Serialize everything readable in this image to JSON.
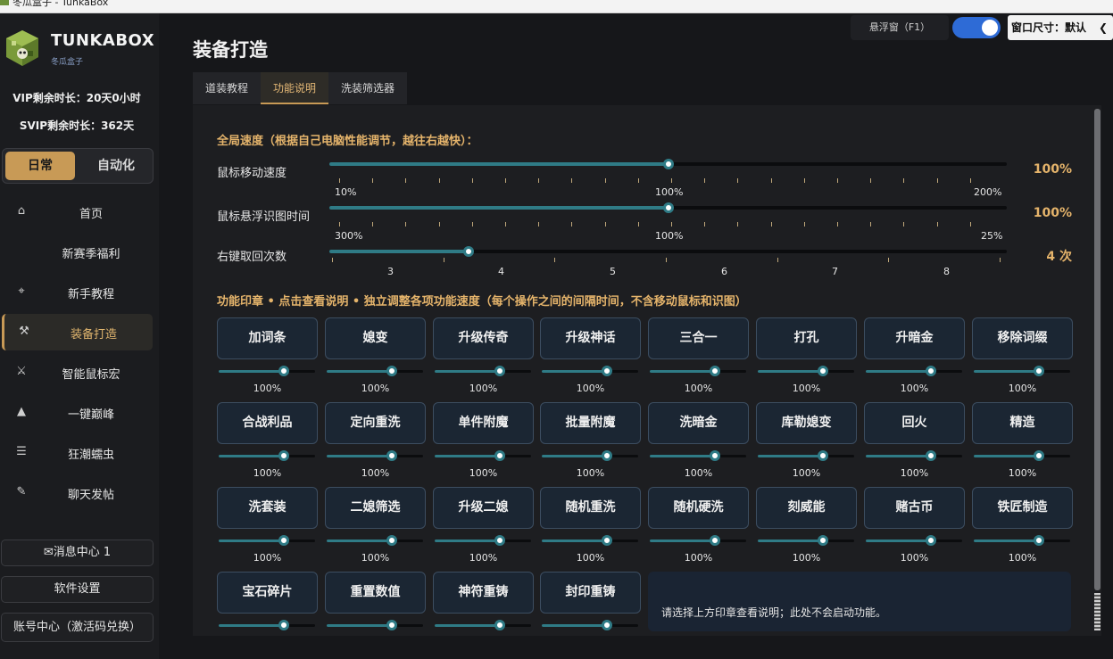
{
  "window": {
    "title": "冬瓜盒子 - TunkaBox"
  },
  "app": {
    "brand": "TUNKABOX",
    "brand_sub": "冬瓜盒子",
    "vip": "VIP剩余时长：20天0小时",
    "svip": "SVIP剩余时长：362天"
  },
  "mode": {
    "daily": "日常",
    "auto": "自动化"
  },
  "nav": [
    {
      "label": "首页",
      "icon": "home-icon",
      "glyph": "⌂"
    },
    {
      "label": "新赛季福利",
      "icon": "",
      "glyph": ""
    },
    {
      "label": "新手教程",
      "icon": "crosshair-icon",
      "glyph": "⌖"
    },
    {
      "label": "装备打造",
      "icon": "hammer-icon",
      "glyph": "⚒"
    },
    {
      "label": "智能鼠标宏",
      "icon": "swords-icon",
      "glyph": "⚔"
    },
    {
      "label": "一键巅峰",
      "icon": "triangle-up-icon",
      "glyph": "▲"
    },
    {
      "label": "狂潮蠕虫",
      "icon": "list-icon",
      "glyph": "☰"
    },
    {
      "label": "聊天发帖",
      "icon": "pen-icon",
      "glyph": "✎"
    }
  ],
  "side_buttons": {
    "messages": "✉消息中心  1",
    "settings": "软件设置",
    "account": "账号中心（激活码兑换）"
  },
  "topbar": {
    "float_label": "悬浮窗（F1）",
    "float_on": true,
    "window_size": "窗口尺寸：默认"
  },
  "page": {
    "title": "装备打造",
    "tabs": [
      "道装教程",
      "功能说明",
      "洗装筛选器"
    ],
    "active_tab": 1
  },
  "speed": {
    "heading": "全局速度（根据自己电脑性能调节，越往右越快）：",
    "sliders": [
      {
        "label": "鼠标移动速度",
        "value": "100%",
        "ticks": [
          "10%",
          "100%",
          "200%"
        ]
      },
      {
        "label": "鼠标悬浮识图时间",
        "value": "100%",
        "ticks": [
          "300%",
          "100%",
          "25%"
        ]
      },
      {
        "label": "右键取回次数",
        "value": "4 次",
        "ticks": [
          "3",
          "4",
          "5",
          "6",
          "7",
          "8"
        ]
      }
    ]
  },
  "functions": {
    "heading": "功能印章 • 点击查看说明 • 独立调整各项功能速度（每个操作之间的间隔时间，不含移动鼠标和识图）",
    "items": [
      {
        "label": "加词条",
        "pct": "100%"
      },
      {
        "label": "媳变",
        "pct": "100%"
      },
      {
        "label": "升级传奇",
        "pct": "100%"
      },
      {
        "label": "升级神话",
        "pct": "100%"
      },
      {
        "label": "三合一",
        "pct": "100%"
      },
      {
        "label": "打孔",
        "pct": "100%"
      },
      {
        "label": "升暗金",
        "pct": "100%"
      },
      {
        "label": "移除词缀",
        "pct": "100%"
      },
      {
        "label": "合战利品",
        "pct": "100%"
      },
      {
        "label": "定向重洗",
        "pct": "100%"
      },
      {
        "label": "单件附魔",
        "pct": "100%"
      },
      {
        "label": "批量附魔",
        "pct": "100%"
      },
      {
        "label": "洗暗金",
        "pct": "100%"
      },
      {
        "label": "库勒媳变",
        "pct": "100%"
      },
      {
        "label": "回火",
        "pct": "100%"
      },
      {
        "label": "精造",
        "pct": "100%"
      },
      {
        "label": "洗套装",
        "pct": "100%"
      },
      {
        "label": "二媳筛选",
        "pct": "100%"
      },
      {
        "label": "升级二媳",
        "pct": "100%"
      },
      {
        "label": "随机重洗",
        "pct": "100%"
      },
      {
        "label": "随机硬洗",
        "pct": "100%"
      },
      {
        "label": "刻威能",
        "pct": "100%"
      },
      {
        "label": "赌古币",
        "pct": "100%"
      },
      {
        "label": "铁匠制造",
        "pct": "100%"
      },
      {
        "label": "宝石碎片",
        "pct": ""
      },
      {
        "label": "重置数值",
        "pct": ""
      },
      {
        "label": "神符重铸",
        "pct": ""
      },
      {
        "label": "封印重铸",
        "pct": ""
      }
    ],
    "description": "请选择上方印章查看说明；此处不会启动功能。"
  },
  "colors": {
    "accent": "#c89a56",
    "value": "#e5b46b",
    "slider": "#2f7b86",
    "toggle": "#2e6bd6"
  }
}
